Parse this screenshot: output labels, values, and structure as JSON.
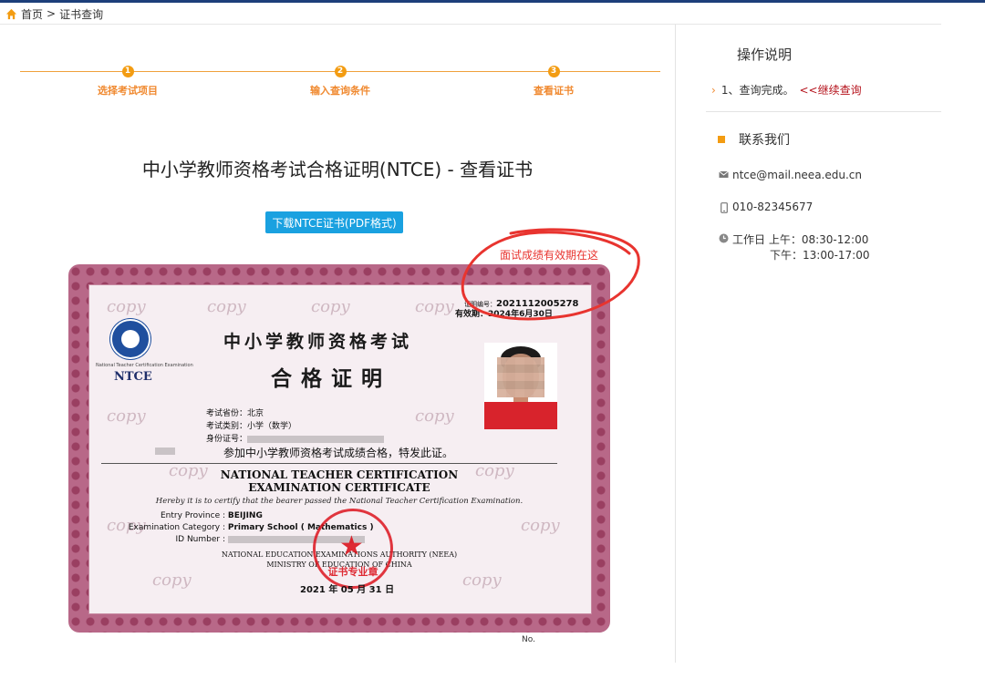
{
  "breadcrumb": {
    "home": "首页",
    "separator": ">",
    "current": "证书查询"
  },
  "steps": [
    {
      "num": "1",
      "label": "选择考试项目"
    },
    {
      "num": "2",
      "label": "输入查询条件"
    },
    {
      "num": "3",
      "label": "查看证书"
    }
  ],
  "page_title": "中小学教师资格考试合格证明(NTCE) - 查看证书",
  "download_button": "下载NTCE证书(PDF格式)",
  "annotation": "面试成绩有效期在这",
  "certificate": {
    "watermark": "copy",
    "logo_text": "NTCE",
    "logo_subtext": "National Teacher Certification Examination",
    "title_line1": "中小学教师资格考试",
    "title_line2": "合格证明",
    "cert_no_label": "证明编号：",
    "cert_no": "2021112005278",
    "valid_label": "有效期：",
    "valid_until": "2024年6月30日",
    "province_label": "考试省份：",
    "province": "北京",
    "category_label": "考试类别：",
    "category": "小学（数学）",
    "id_label": "身份证号：",
    "statement_cn": "参加中小学教师资格考试成绩合格，特发此证。",
    "title_en_1": "NATIONAL TEACHER CERTIFICATION",
    "title_en_2": "EXAMINATION CERTIFICATE",
    "statement_en": "Hereby it is to certify that the bearer passed the National Teacher Certification Examination.",
    "entry_province_label": "Entry Province :",
    "entry_province": "BEIJING",
    "exam_category_label": "Examination Category :",
    "exam_category": "Primary School ( Mathematics )",
    "id_number_label": "ID Number :",
    "authority_1": "NATIONAL EDUCATION EXAMINATIONS AUTHORITY (NEEA)",
    "authority_2": "MINISTRY OF EDUCATION OF CHINA",
    "date": "2021 年 05 月 31 日",
    "seal_text": "证书专业章",
    "no_label": "No."
  },
  "sidebar": {
    "title": "操作说明",
    "step_text": "1、查询完成。",
    "continue_link": "<<继续查询",
    "contact_title": "联系我们",
    "email": "ntce@mail.neea.edu.cn",
    "phone": "010-82345677",
    "hours_label": "工作日",
    "hours_am": "上午：08:30-12:00",
    "hours_pm": "下午：13:00-17:00"
  },
  "colors": {
    "accent_orange": "#f39c12",
    "button_blue": "#1aa1e0",
    "link_red": "#b5121b",
    "annotation_red": "#e8342f"
  }
}
